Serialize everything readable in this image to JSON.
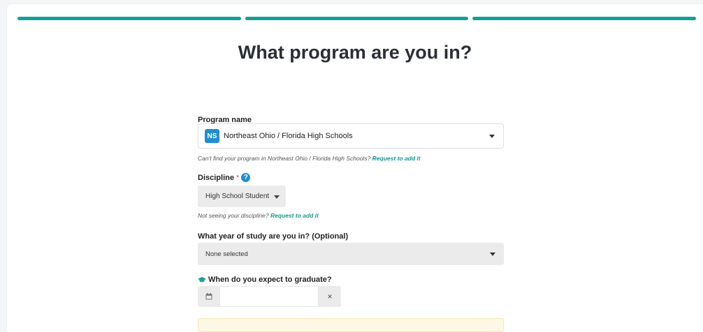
{
  "title": "What program are you in?",
  "progress_segments": 3,
  "program": {
    "label": "Program name",
    "badge": "NS",
    "value": "Northeast Ohio / Florida High Schools",
    "hint_text": "Can't find your program in Northeast Ohio / Florida High Schools?",
    "hint_link": "Request to add it"
  },
  "discipline": {
    "label": "Discipline",
    "required_mark": "*",
    "help": "?",
    "value": "High School Student",
    "hint_text": "Not seeing your discipline?",
    "hint_link": "Request to add it"
  },
  "year": {
    "label": "What year of study are you in? (Optional)",
    "value": "None selected"
  },
  "graduation": {
    "icon": "graduation-cap-icon",
    "label": "When do you expect to graduate?",
    "value": "",
    "calendar_icon": "calendar-icon",
    "clear": "×"
  },
  "colors": {
    "accent": "#14a097",
    "link": "#129a92",
    "badge": "#1f8fd1",
    "required": "#e05a5a"
  }
}
